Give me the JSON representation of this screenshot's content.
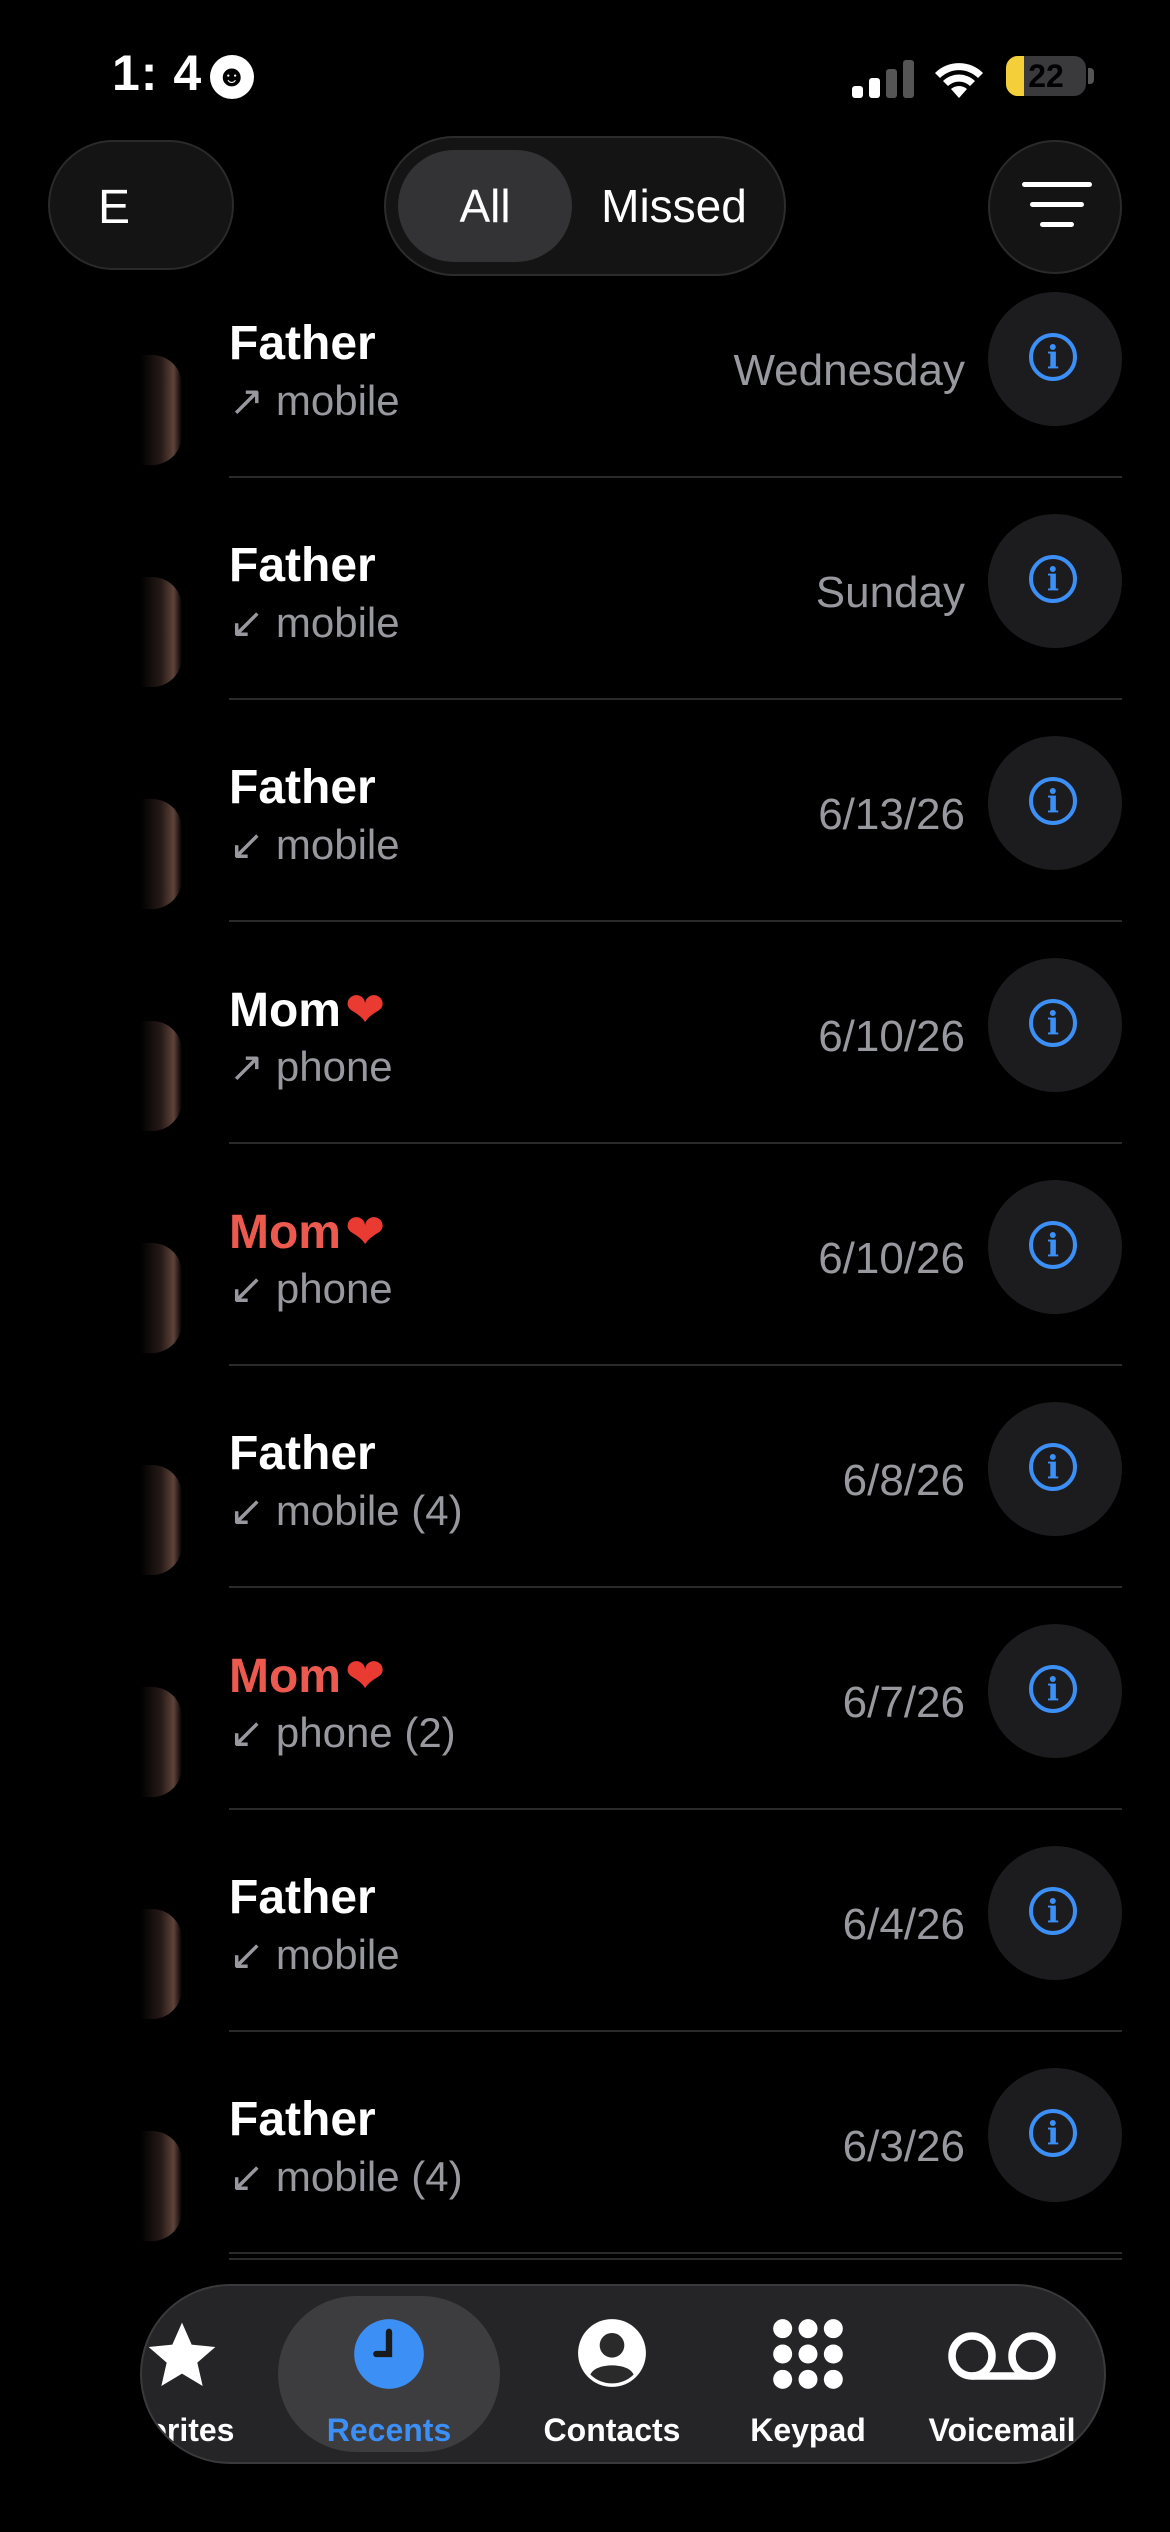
{
  "status_bar": {
    "time": "1:  4",
    "battery": "22",
    "battery_level": 0.22
  },
  "header": {
    "edit_label": "E",
    "segments": {
      "all": "All",
      "missed": "Missed"
    },
    "selected_segment": "All"
  },
  "calls": [
    {
      "name": "Father",
      "heart": "",
      "arrow": "↗",
      "type": "mobile",
      "date": "Wednesday",
      "missed": false
    },
    {
      "name": "Father",
      "heart": "",
      "arrow": "↙",
      "type": "mobile",
      "date": "Sunday",
      "missed": false
    },
    {
      "name": "Father",
      "heart": "",
      "arrow": "↙",
      "type": "mobile",
      "date": "6/13/26",
      "missed": false
    },
    {
      "name": "Mom",
      "heart": "❤",
      "arrow": "↗",
      "type": "phone",
      "date": "6/10/26",
      "missed": false
    },
    {
      "name": "Mom",
      "heart": "❤",
      "arrow": "↙",
      "type": "phone",
      "date": "6/10/26",
      "missed": true
    },
    {
      "name": "Father",
      "heart": "",
      "arrow": "↙",
      "type": "mobile (4)",
      "date": "6/8/26",
      "missed": false
    },
    {
      "name": "Mom",
      "heart": "❤",
      "arrow": "↙",
      "type": "phone (2)",
      "date": "6/7/26",
      "missed": true
    },
    {
      "name": "Father",
      "heart": "",
      "arrow": "↙",
      "type": "mobile",
      "date": "6/4/26",
      "missed": false
    },
    {
      "name": "Father",
      "heart": "",
      "arrow": "↙",
      "type": "mobile (4)",
      "date": "6/3/26",
      "missed": false
    }
  ],
  "tab_bar": {
    "favorites": "vorites",
    "recents": "Recents",
    "contacts": "Contacts",
    "keypad": "Keypad",
    "voicemail": "Voicemail",
    "active": "recents"
  },
  "colors": {
    "accent": "#3b8ff5",
    "missed": "#ec5a4f",
    "secondary_text": "#98989f",
    "background": "#000000"
  }
}
